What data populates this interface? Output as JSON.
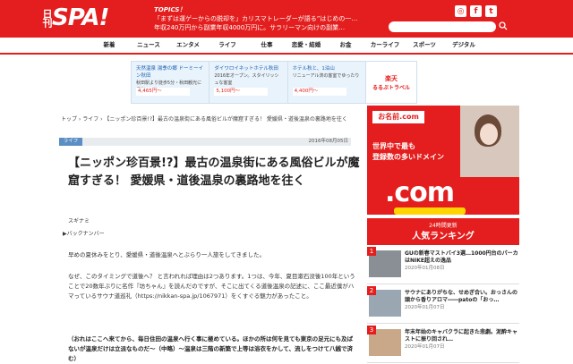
{
  "header": {
    "logo_small": "日刊",
    "logo_main": "SPA!",
    "topics_label": "TOPICS！",
    "topics": [
      "「まずは運ゲーからの脱却を」カリスマトレーダーが語る”はじめの一…",
      "年収240万円から副業年収4000万円に。サラリーマン向けの副業…"
    ],
    "social": [
      "◎",
      "f",
      "t"
    ],
    "search_icon": "search-icon"
  },
  "nav": [
    "新着",
    "ニュース",
    "エンタメ",
    "ライフ",
    "仕事",
    "恋愛・結婚",
    "お金",
    "カーライフ",
    "スポーツ",
    "デジタル"
  ],
  "ads": [
    {
      "title": "天然温泉 湯季の郷 ドーミーイン秋田",
      "desc": "秋田駅より徒歩5分・秋田観光に便利",
      "price": "4,465円～"
    },
    {
      "title": "ダイワロイネットホテル秋田",
      "desc": "2016年オープン。スタイリッシュな客室",
      "price": "5,100円～"
    },
    {
      "title": "ホテル秋と、1泊山",
      "desc": "リニューアル済の客室でゆったり",
      "price": "4,400円～"
    }
  ],
  "ad_brand": "楽天",
  "ad_brand_sub": "るるぶトラベル",
  "breadcrumb": "トップ › ライフ › 【ニッポン珍百景!?】最古の温泉街にある風俗ビルが魔窟すぎる！ 愛媛県・道後温泉の裏路地を往く",
  "article": {
    "category": "ライフ",
    "date": "2016年08月05日",
    "title": "【ニッポン珍百景!?】最古の温泉街にある風俗ビルが魔窟すぎる！ 愛媛県・道後温泉の裏路地を往く",
    "author": "スギナミ",
    "backnumber": "▶バックナンバー",
    "p1": "早めの夏休みをとり、愛媛県・道後温泉へとぶらり一人旅をしてきました。",
    "p2": "なぜ、このタイミングで道後へ？ と言われれば理由は2つあります。1つは、今年、夏目漱石没後100年ということで20数年ぶりに名作『坊ちゃん』を読んだのですが、そこに出てくる道後温泉の記述に、ここ最近僕がハマっているサウナ道巡礼（https://nikkan-spa.jp/1067971）をくすぐる魅力があったこと。",
    "p3": "（おれはここへ来てから、毎日住田の温泉へ行く事に極めている。ほかの所は何を見ても東京の足元にも及ばないが温泉だけは立派なものだ〜（中略）〜温泉は三階の新築で上等は浴衣をかして、流しをつけて八銭で済む）"
  },
  "side_ad": {
    "brand": "お名前.com",
    "line1": "世界中で最も",
    "line2": "登録数の多いドメイン",
    "dotcom": ".com"
  },
  "ranking": {
    "sub": "24時間更新",
    "title": "人気ランキング",
    "items": [
      {
        "num": "1",
        "text": "GUの新春マストバイ3選…1000円台のパーカはNIKE超えの逸品",
        "date": "2020年01月08日"
      },
      {
        "num": "2",
        "text": "サウナにありがちな、せめぎ合い。おっさんの頭から香りアロマ――patoの「おっ…",
        "date": "2020年01月07日"
      },
      {
        "num": "3",
        "text": "年末年始のキャバクラに起きた悲劇。泥酔キャストに振り回され…",
        "date": "2020年01月07日"
      }
    ]
  },
  "colors": {
    "brand": "#e41e1e",
    "category": "#5b8ec3"
  }
}
